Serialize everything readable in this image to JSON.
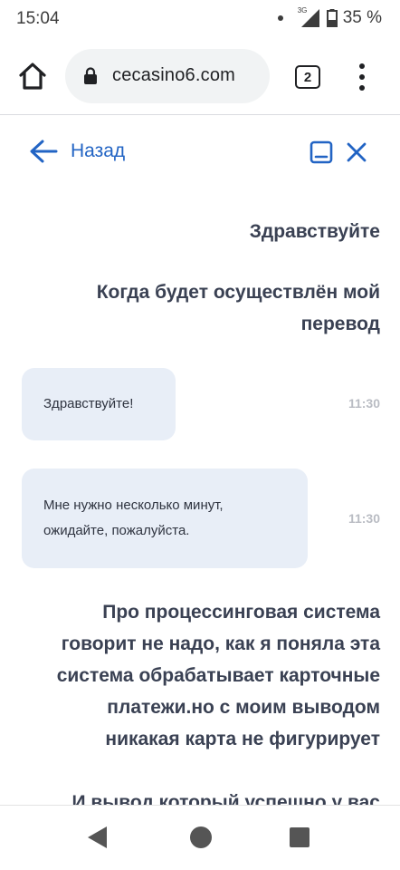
{
  "status_bar": {
    "time": "15:04",
    "network": "3G",
    "battery": "35 %"
  },
  "browser": {
    "url": "cecasino6.com",
    "tab_count": "2",
    "icons": [
      "home-icon",
      "lock-icon",
      "tab-switcher-icon",
      "more-vert-icon"
    ]
  },
  "chat_header": {
    "back_label": "Назад",
    "accent_color": "#2264c4"
  },
  "messages": [
    {
      "side": "out",
      "text": "Здравствуйте"
    },
    {
      "side": "out",
      "text": "Когда будет осуществлён мой перевод"
    },
    {
      "side": "in",
      "text": "Здравствуйте!",
      "time": "11:30"
    },
    {
      "side": "in",
      "text": "Мне нужно несколько минут, ожидайте, пожалуйста.",
      "time": "11:30"
    },
    {
      "side": "out",
      "text": "Про процессинговая система говорит не надо, как я поняла эта система обрабатывает карточные платежи.но с моим выводом никакая карта не фигурирует"
    },
    {
      "side": "out",
      "text": "И вывод который успешно у вас"
    }
  ],
  "colors": {
    "incoming_bubble": "#e8eef7",
    "outgoing_text": "#3a4153",
    "timestamp": "#b9bcc3"
  }
}
